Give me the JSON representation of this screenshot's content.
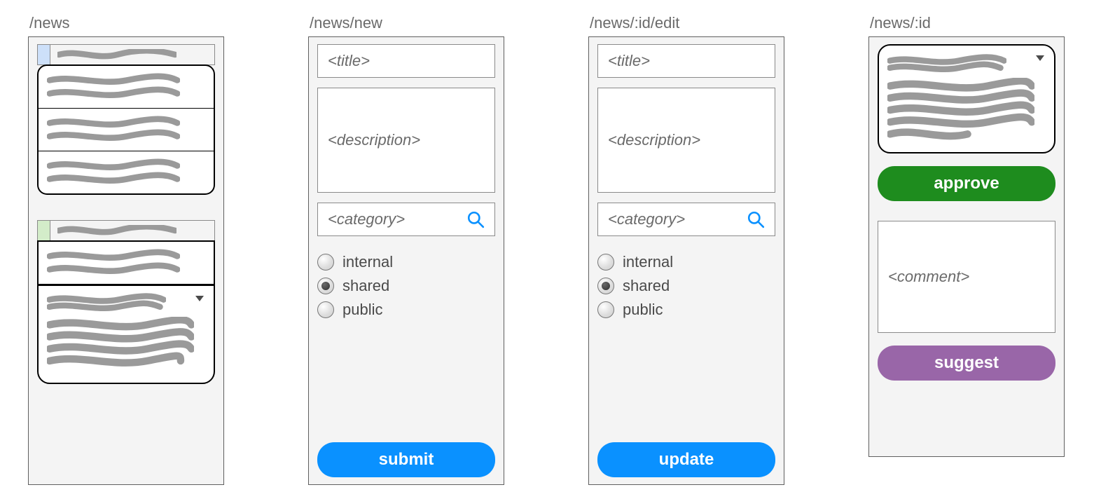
{
  "routes": {
    "list": "/news",
    "new": "/news/new",
    "edit": "/news/:id/edit",
    "show": "/news/:id"
  },
  "form": {
    "title_placeholder": "<title>",
    "description_placeholder": "<description>",
    "category_placeholder": "<category>",
    "visibility": {
      "options": [
        "internal",
        "shared",
        "public"
      ],
      "selected": "shared"
    },
    "submit_label": "submit",
    "update_label": "update"
  },
  "detail": {
    "approve_label": "approve",
    "comment_placeholder": "<comment>",
    "suggest_label": "suggest"
  },
  "colors": {
    "button_primary": "#0a91ff",
    "button_approve": "#1e8c1e",
    "button_suggest": "#9966a8",
    "chip_blue": "#cde0f9",
    "chip_green": "#d3ecc9"
  }
}
